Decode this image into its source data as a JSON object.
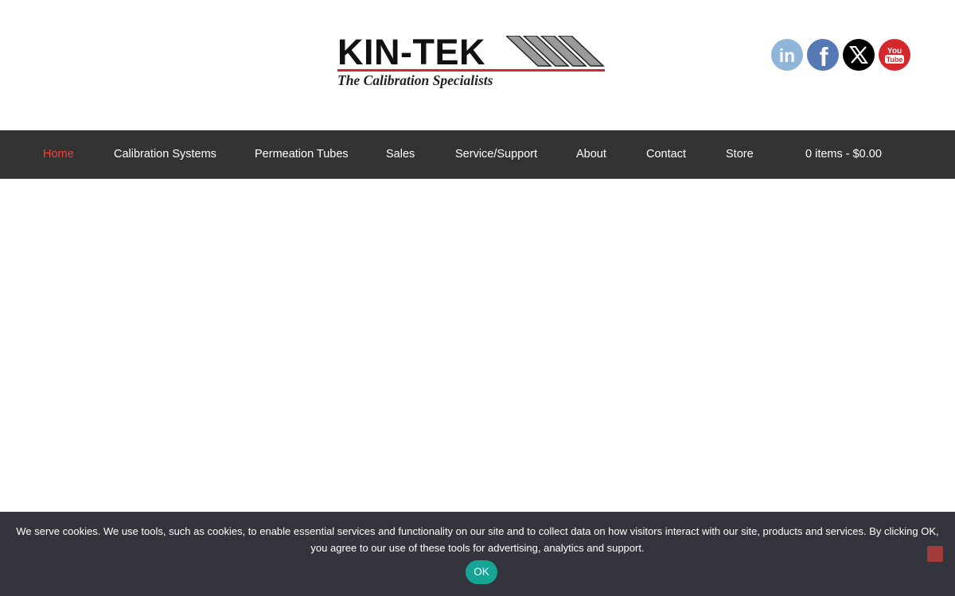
{
  "header": {
    "logo": {
      "wordmark": "KIN-TEK",
      "tagline": "The Calibration Specialists"
    },
    "social": [
      {
        "name": "LinkedIn",
        "icon": "linkedin-icon",
        "glyph": "in"
      },
      {
        "name": "Facebook",
        "icon": "facebook-icon",
        "glyph": "f"
      },
      {
        "name": "X",
        "icon": "x-icon"
      },
      {
        "name": "YouTube",
        "icon": "youtube-icon",
        "glyph_top": "You",
        "glyph_bottom": "Tube"
      }
    ]
  },
  "nav": {
    "active_color": "#e8453c",
    "items": [
      {
        "label": "Home",
        "active": true
      },
      {
        "label": "Calibration Systems"
      },
      {
        "label": "Permeation Tubes"
      },
      {
        "label": "Sales"
      },
      {
        "label": "Service/Support"
      },
      {
        "label": "About"
      },
      {
        "label": "Contact"
      },
      {
        "label": "Store"
      }
    ],
    "cart": "0 items - $0.00"
  },
  "cookie_banner": {
    "text": "We serve cookies. We use tools, such as cookies, to enable essential services and functionality on our site and to collect data on how visitors interact with our site, products and services. By clicking OK, you agree to our use of these tools for advertising, analytics and support.",
    "ok_label": "OK"
  }
}
